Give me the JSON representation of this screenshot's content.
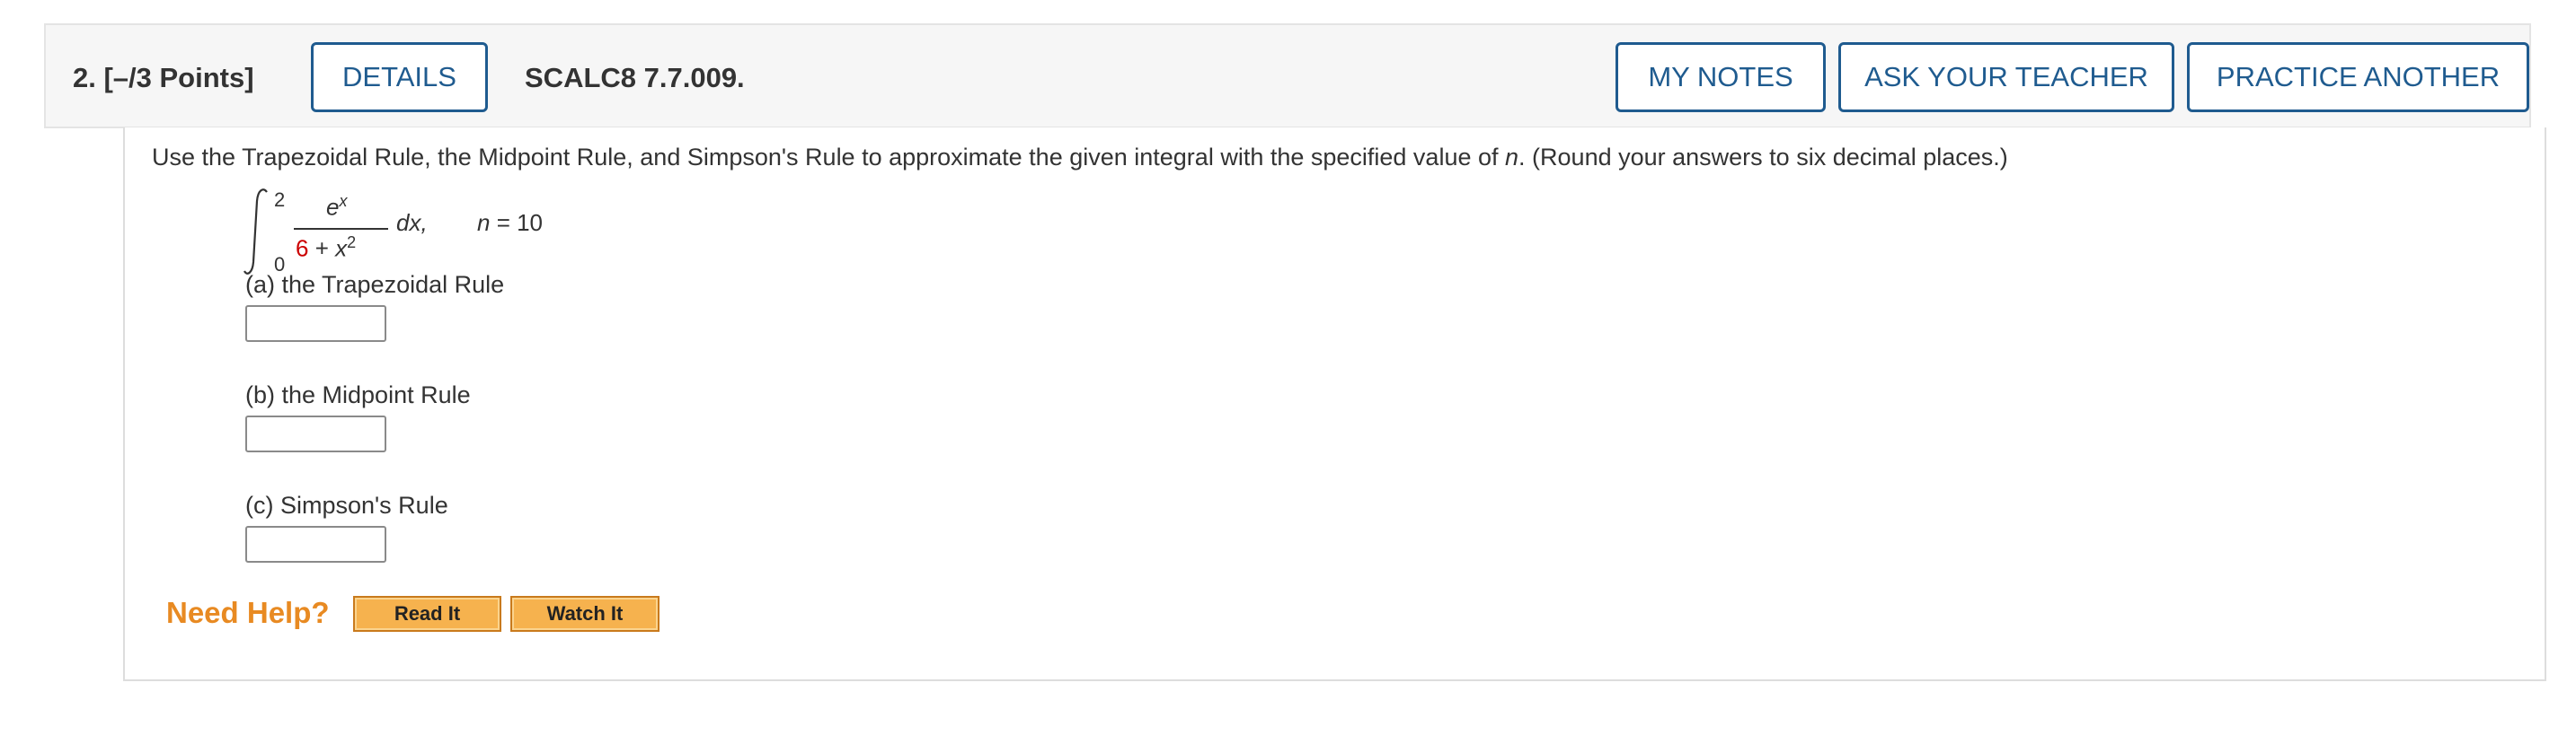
{
  "question": {
    "number_label": "2.  [–/3 Points]",
    "reference": "SCALC8 7.7.009."
  },
  "header_buttons": {
    "details": "DETAILS",
    "my_notes": "MY NOTES",
    "ask_teacher": "ASK YOUR TEACHER",
    "practice_another": "PRACTICE ANOTHER"
  },
  "prompt": {
    "text_before": "Use the Trapezoidal Rule, the Midpoint Rule, and Simpson's Rule to approximate the given integral with the specified value of ",
    "var": "n",
    "text_after": ". (Round your answers to six decimal places.)"
  },
  "integral": {
    "upper_limit": "2",
    "lower_limit": "0",
    "numerator_base": "e",
    "numerator_exp": "x",
    "denominator_const": "6",
    "denominator_op": " + ",
    "denominator_var": "x",
    "denominator_exp": "2",
    "differential": "dx,",
    "n_var": "n",
    "n_eq": " = 10"
  },
  "parts": [
    {
      "label": "(a) the Trapezoidal Rule",
      "value": ""
    },
    {
      "label": "(b) the Midpoint Rule",
      "value": ""
    },
    {
      "label": "(c) Simpson's Rule",
      "value": ""
    }
  ],
  "help": {
    "label": "Need Help?",
    "read_it": "Read It",
    "watch_it": "Watch It"
  }
}
